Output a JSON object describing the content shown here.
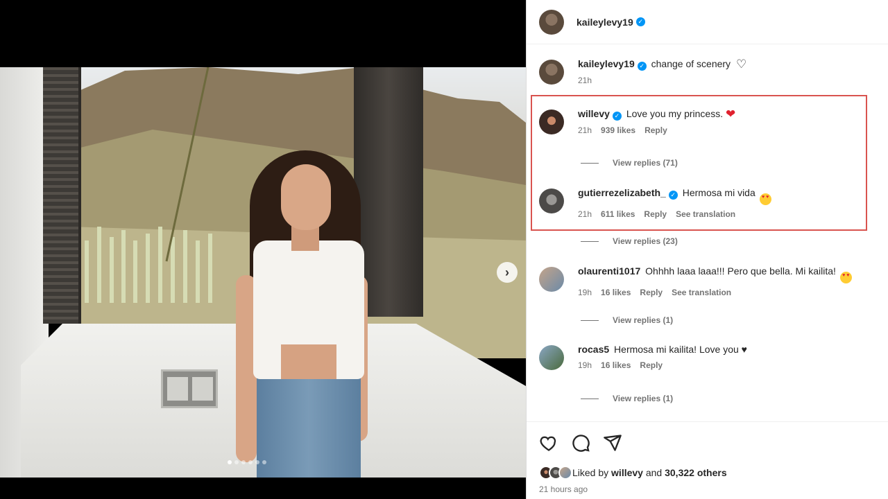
{
  "post": {
    "author": "kaileylevy19",
    "caption": "change of scenery",
    "caption_time": "21h",
    "carousel": {
      "total_slides": 6,
      "active_slide": 1
    }
  },
  "comments": [
    {
      "username": "willevy",
      "text": "Love you my princess.",
      "emoji": "red-heart",
      "time": "21h",
      "likes": "939 likes",
      "reply_label": "Reply",
      "replies": "View replies (71)"
    },
    {
      "username": "gutierrezelizabeth_",
      "text": "Hermosa mi vida",
      "emoji": "heart-eyes",
      "time": "21h",
      "likes": "611 likes",
      "reply_label": "Reply",
      "translation_label": "See translation",
      "replies": "View replies (23)"
    },
    {
      "username": "olaurenti1017",
      "text": "Ohhhh laaa laaa!!! Pero que bella. Mi kailita!",
      "emoji": "heart-eyes",
      "time": "19h",
      "likes": "16 likes",
      "reply_label": "Reply",
      "translation_label": "See translation",
      "replies": "View replies (1)"
    },
    {
      "username": "rocas5",
      "text": "Hermosa mi kailita! Love you ♥",
      "time": "19h",
      "likes": "16 likes",
      "reply_label": "Reply",
      "replies": "View replies (1)"
    }
  ],
  "footer": {
    "liked_prefix": "Liked by",
    "liked_user": "willevy",
    "liked_and": "and",
    "liked_others": "30,322 others",
    "time_ago": "21 hours ago"
  },
  "icons": {
    "verified": "verified-badge-icon",
    "like": "heart-outline-icon",
    "comment": "speech-bubble-icon",
    "share": "paper-plane-icon",
    "next": "chevron-right-icon"
  },
  "colors": {
    "highlight_border": "#d9534f",
    "verified_blue": "#0095f6",
    "secondary_text": "#737373"
  }
}
